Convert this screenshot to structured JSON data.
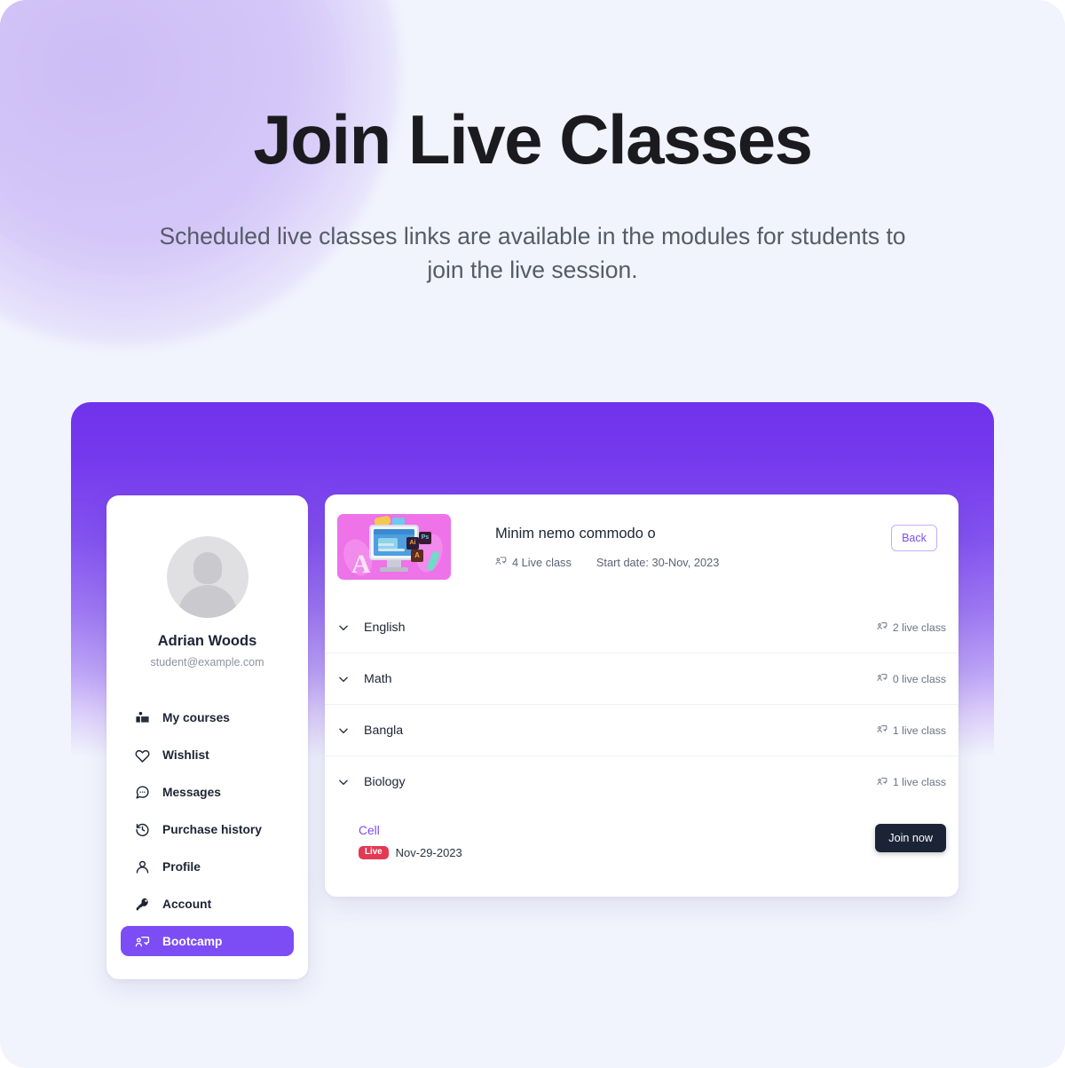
{
  "hero": {
    "title": "Join Live Classes",
    "subtitle": "Scheduled live classes links are available in the modules for students to join the live session."
  },
  "colors": {
    "page_background": "#F1F4FD",
    "panel_gradient_top": "#7033EC",
    "accent_purple": "#7C4DF4",
    "live_badge_red": "#E23A53",
    "join_button_dark": "#1B2437",
    "thumbnail_pink": "#EE72E8"
  },
  "sidebar": {
    "user_name": "Adrian Woods",
    "user_email": "student@example.com",
    "avatar_icon": "avatar-placeholder-icon",
    "items": [
      {
        "label": "My courses",
        "icon": "book-reader-icon",
        "active": false
      },
      {
        "label": "Wishlist",
        "icon": "heart-icon",
        "active": false
      },
      {
        "label": "Messages",
        "icon": "chat-bubble-icon",
        "active": false
      },
      {
        "label": "Purchase history",
        "icon": "clock-rewind-icon",
        "active": false
      },
      {
        "label": "Profile",
        "icon": "user-icon",
        "active": false
      },
      {
        "label": "Account",
        "icon": "key-icon",
        "active": false
      },
      {
        "label": "Bootcamp",
        "icon": "live-class-icon",
        "active": true
      }
    ]
  },
  "course": {
    "title": "Minim nemo commodo o",
    "live_class_count_text": "4 Live class",
    "live_class_icon": "live-class-icon",
    "start_date_text": "Start date: 30-Nov, 2023",
    "back_label": "Back",
    "thumbnail_icon": "course-thumbnail-illustration"
  },
  "modules": [
    {
      "name": "English",
      "count_text": "2 live class",
      "chevron": "chevron-down-icon",
      "expanded": false
    },
    {
      "name": "Math",
      "count_text": "0 live class",
      "chevron": "chevron-down-icon",
      "expanded": false
    },
    {
      "name": "Bangla",
      "count_text": "1 live class",
      "chevron": "chevron-down-icon",
      "expanded": false
    },
    {
      "name": "Biology",
      "count_text": "1 live class",
      "chevron": "chevron-down-icon",
      "expanded": true
    }
  ],
  "live_class": {
    "name": "Cell",
    "badge": "Live",
    "date": "Nov-29-2023",
    "join_label": "Join now"
  }
}
